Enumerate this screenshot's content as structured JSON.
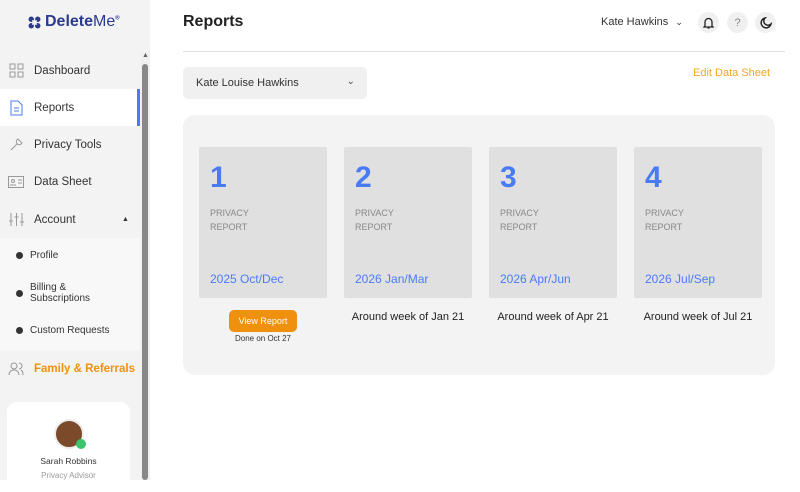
{
  "brand": {
    "name_bold": "Delete",
    "name_light": "Me",
    "mark": "®"
  },
  "sidebar": {
    "items": [
      {
        "label": "Dashboard",
        "icon": "grid-icon"
      },
      {
        "label": "Reports",
        "icon": "document-icon"
      },
      {
        "label": "Privacy Tools",
        "icon": "wrench-icon"
      },
      {
        "label": "Data Sheet",
        "icon": "id-card-icon"
      },
      {
        "label": "Account",
        "icon": "sliders-icon"
      }
    ],
    "account_sub": [
      "Profile",
      "Billing & Subscriptions",
      "Custom Requests"
    ],
    "family": "Family & Referrals",
    "advisor": {
      "name": "Sarah Robbins",
      "role": "Privacy Advisor"
    }
  },
  "header": {
    "title": "Reports",
    "user": "Kate Hawkins",
    "help": "?"
  },
  "profile_select": "Kate Louise Hawkins",
  "edit_link": "Edit Data Sheet",
  "report_label": [
    "PRIVACY",
    "REPORT"
  ],
  "reports": [
    {
      "num": "1",
      "period": "2025 Oct/Dec",
      "button": "View Report",
      "done": "Done on Oct 27"
    },
    {
      "num": "2",
      "period": "2026 Jan/Mar",
      "eta": "Around week of Jan 21"
    },
    {
      "num": "3",
      "period": "2026 Apr/Jun",
      "eta": "Around week of Apr 21"
    },
    {
      "num": "4",
      "period": "2026 Jul/Sep",
      "eta": "Around week of Jul 21"
    }
  ],
  "colors": {
    "accent": "#4a7bf7",
    "orange": "#f0900f"
  }
}
